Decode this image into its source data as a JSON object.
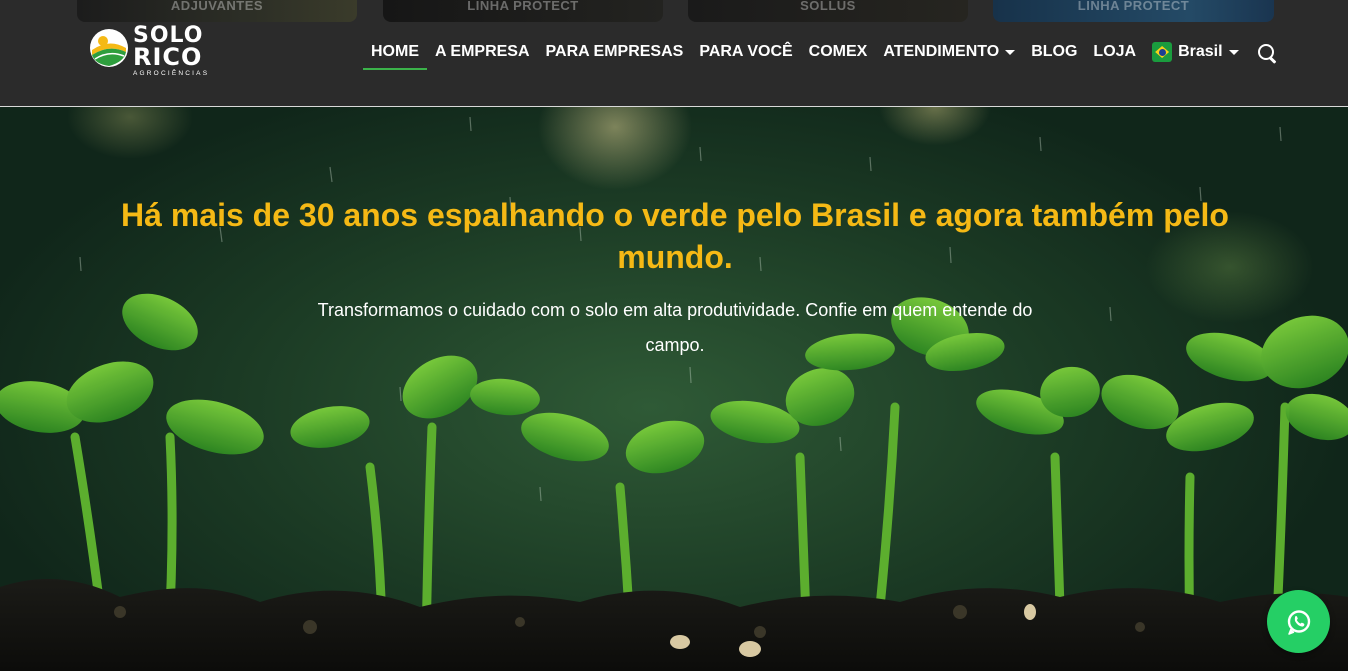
{
  "cards": [
    "ADJUVANTES",
    "LINHA PROTECT",
    "SOLLUS",
    "LINHA PROTECT"
  ],
  "logo": {
    "line1": "SOLO",
    "line2": "RICO",
    "tagline": "AGROCIÊNCIAS",
    "registered": "®"
  },
  "nav": {
    "items": [
      {
        "label": "HOME",
        "active": true
      },
      {
        "label": "A EMPRESA"
      },
      {
        "label": "PARA EMPRESAS"
      },
      {
        "label": "PARA VOCÊ"
      },
      {
        "label": "COMEX"
      },
      {
        "label": "ATENDIMENTO",
        "dropdown": true
      },
      {
        "label": "BLOG"
      },
      {
        "label": "LOJA"
      }
    ],
    "country": {
      "label": "Brasil",
      "flag": "brazil-flag-icon"
    },
    "search_icon": "search-icon"
  },
  "hero": {
    "title": "Há mais de 30 anos espalhando o verde pelo Brasil e agora também pelo mundo.",
    "subtitle": "Transformamos o cuidado com o solo em alta produtividade. Confie em quem entende do campo."
  },
  "whatsapp": {
    "icon": "whatsapp-icon"
  },
  "colors": {
    "title": "#f5b915",
    "accent": "#3bb34a",
    "header_bg": "#2b2b2b",
    "whatsapp": "#25cf65"
  }
}
